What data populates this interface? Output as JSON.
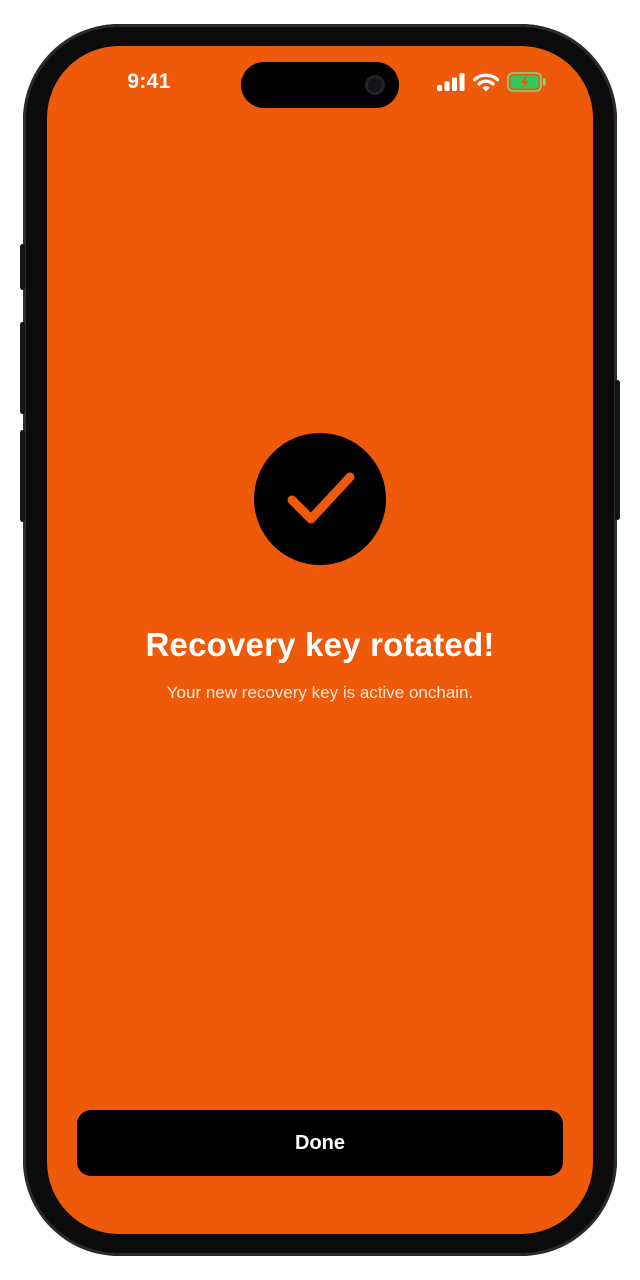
{
  "status_bar": {
    "time": "9:41",
    "signal_icon": "cellular-signal-icon",
    "wifi_icon": "wifi-icon",
    "battery_icon": "battery-charging-icon",
    "battery_color": "#34c759"
  },
  "success": {
    "icon": "checkmark-icon",
    "title": "Recovery key rotated!",
    "message": "Your new recovery key is active onchain."
  },
  "actions": {
    "done_label": "Done"
  },
  "colors": {
    "background": "#ee5a0a",
    "button": "#000000",
    "text": "#ffffff"
  }
}
